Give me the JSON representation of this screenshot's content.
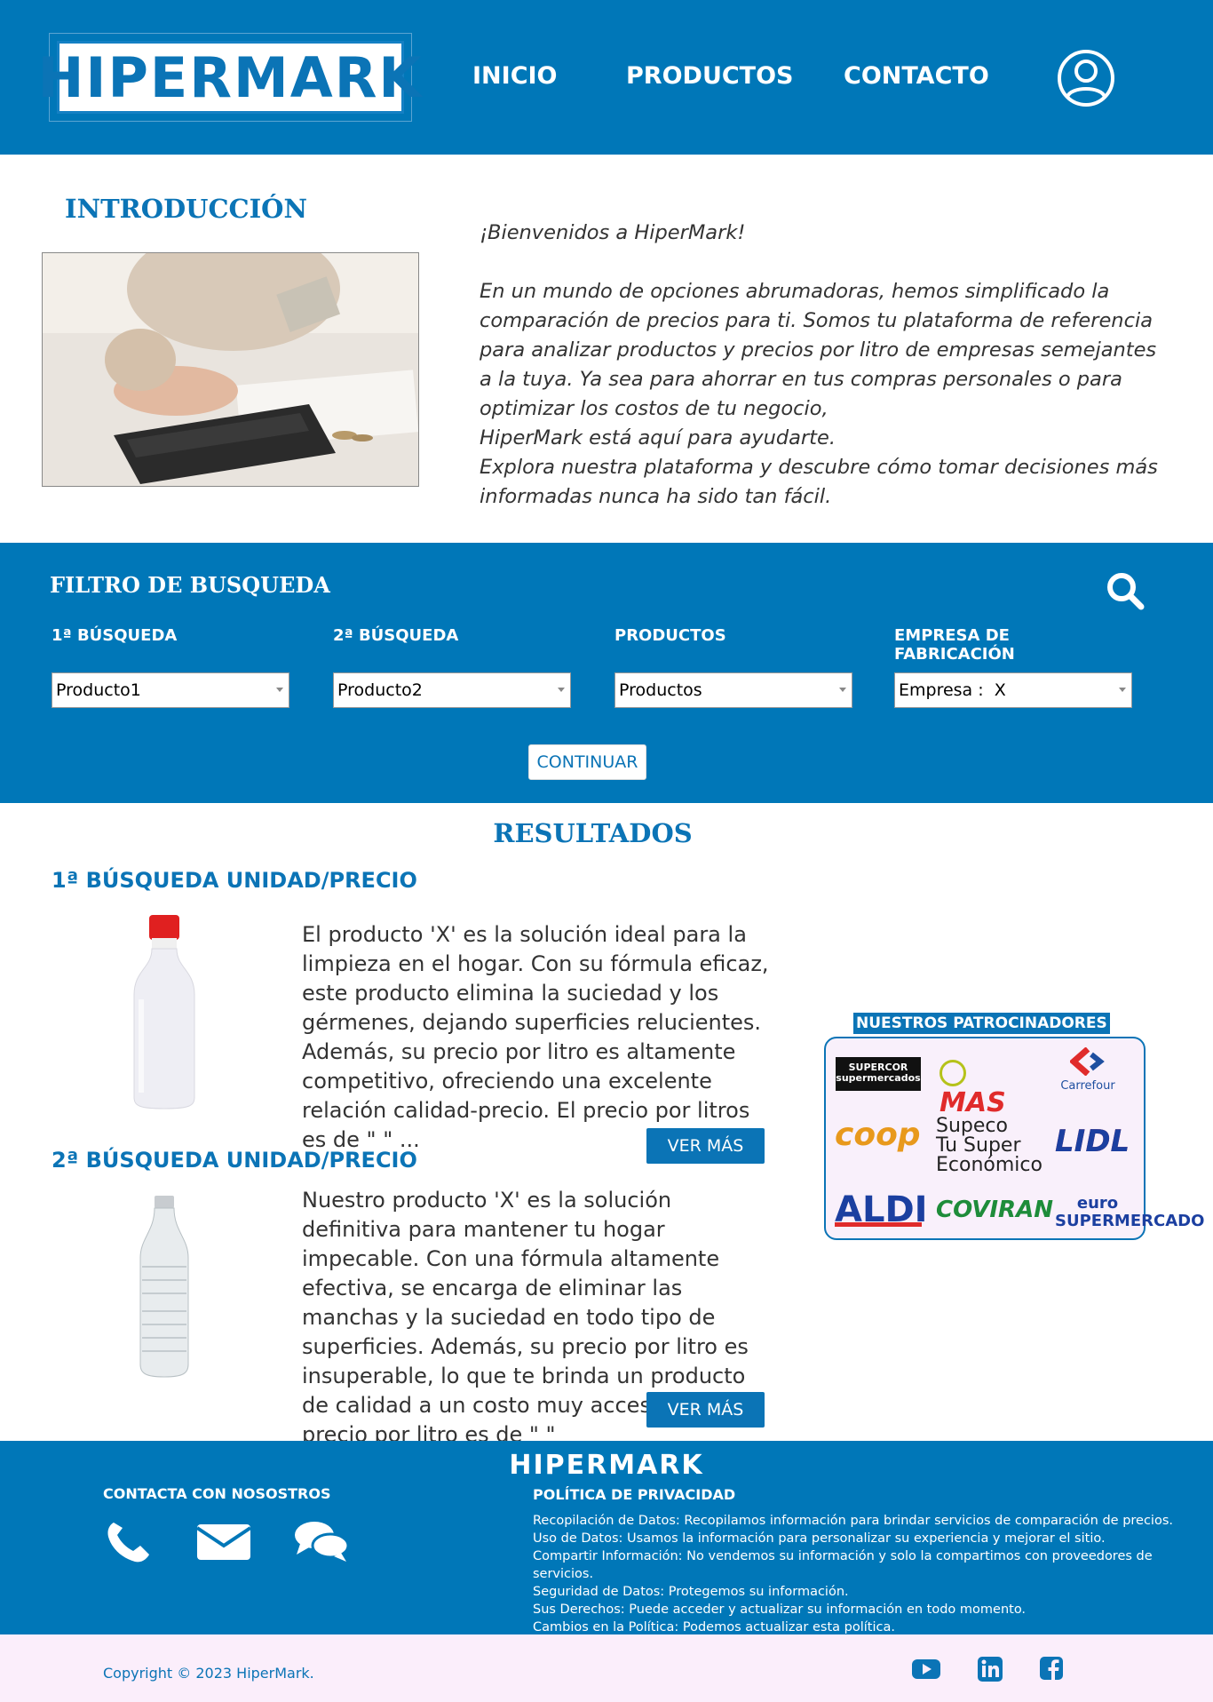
{
  "header": {
    "logo": "HIPERMARK",
    "nav": [
      "INICIO",
      "PRODUCTOS",
      "CONTACTO"
    ],
    "user_icon": "user-circle-icon"
  },
  "intro": {
    "title": "INTRODUCCIÓN",
    "image": "calculator-money-photo",
    "greeting": "¡Bienvenidos a HiperMark!",
    "paragraph": "En un mundo de opciones abrumadoras, hemos simplificado la comparación de precios para ti. Somos tu plataforma de referencia para analizar productos y precios por litro de empresas semejantes a la tuya. Ya sea para ahorrar en tus compras personales o para optimizar los costos de tu negocio,",
    "line2": "HiperMark está aquí para ayudarte.",
    "line3": "Explora nuestra plataforma y descubre cómo tomar decisiones más informadas nunca ha sido tan fácil."
  },
  "filter": {
    "title": "FILTRO DE BUSQUEDA",
    "search_icon": "search-icon",
    "fields": [
      {
        "label": "1ª BÚSQUEDA",
        "value": "Producto1"
      },
      {
        "label": "2ª BÚSQUEDA",
        "value": "Producto2"
      },
      {
        "label": "PRODUCTOS",
        "value": "Productos"
      },
      {
        "label": "EMPRESA DE FABRICACIÓN",
        "value": "Empresa :  X"
      }
    ],
    "continue_label": "CONTINUAR"
  },
  "results": {
    "title": "RESULTADOS",
    "items": [
      {
        "heading": "1ª BÚSQUEDA UNIDAD/PRECIO",
        "text": "El producto 'X' es la solución ideal para la limpieza en el hogar. Con su fórmula eficaz, este producto elimina la suciedad y los gérmenes, dejando superficies relucientes. Además, su precio por litro es altamente competitivo, ofreciendo una excelente relación calidad-precio. El precio por litros es de \" \" ...",
        "more_label": "VER MÁS"
      },
      {
        "heading": "2ª BÚSQUEDA UNIDAD/PRECIO",
        "text": "Nuestro producto 'X' es la solución definitiva para mantener tu hogar impecable. Con una fórmula altamente efectiva, se encarga de eliminar las manchas y la suciedad en todo tipo de superficies. Además, su precio por litro es insuperable, lo que te brinda un producto de calidad a un costo muy accesible. El precio por litro es de \" \"",
        "more_label": "VER MÁS"
      }
    ]
  },
  "sponsors": {
    "title": "NUESTROS PATROCINADORES",
    "logos": [
      "SUPERCOR supermercados",
      "MAS",
      "Carrefour",
      "coop",
      "Supeco Tu Super Económico",
      "LIDL",
      "ALDI",
      "COVIRAN",
      "euro SUPERMERCADO"
    ]
  },
  "footer": {
    "logo": "HIPERMARK",
    "contact_title": "CONTACTA CON NOSOSTROS",
    "contact_icons": [
      "phone-icon",
      "mail-icon",
      "chat-icon"
    ],
    "privacy_title": "POLÍTICA DE PRIVACIDAD",
    "privacy_items": [
      "Recopilación de Datos: Recopilamos información para brindar servicios de comparación de precios.",
      "Uso de Datos: Usamos la información para personalizar su experiencia y mejorar el sitio.",
      "Compartir Información: No vendemos su información y solo la compartimos con proveedores de servicios.",
      "Seguridad de Datos: Protegemos su información.",
      "Sus Derechos: Puede acceder y actualizar su información en todo momento.",
      "Cambios en la Política: Podemos actualizar esta política."
    ],
    "copyright": "Copyright © 2023 HiperMark.",
    "social": [
      "youtube-icon",
      "linkedin-icon",
      "facebook-icon"
    ]
  },
  "colors": {
    "primary": "#0077b8",
    "accent": "#0b74b6",
    "bottom_bar": "#fbeefb",
    "white": "#ffffff"
  }
}
